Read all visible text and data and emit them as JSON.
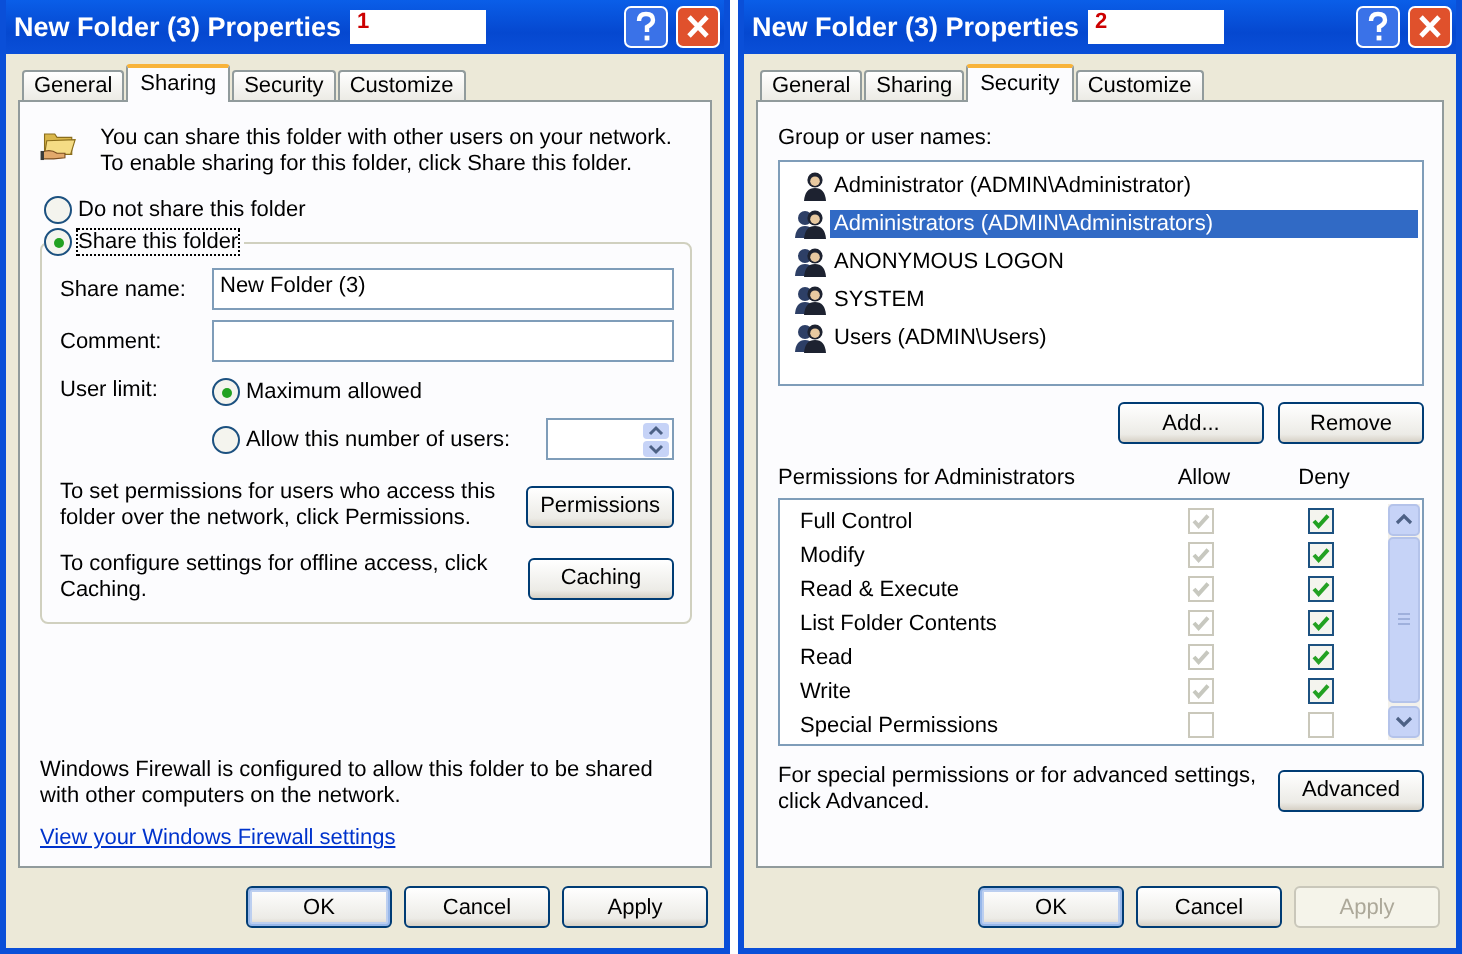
{
  "dialogs": [
    {
      "kind": "sharing",
      "title": "New Folder (3) Properties",
      "badge": "1",
      "tabs": [
        {
          "label": "General",
          "selected": false
        },
        {
          "label": "Sharing",
          "selected": true
        },
        {
          "label": "Security",
          "selected": false
        },
        {
          "label": "Customize",
          "selected": false
        }
      ],
      "intro": "You can share this folder with other users on your network.  To enable sharing for this folder, click Share this folder.",
      "share_options": [
        {
          "label": "Do not share this folder",
          "selected": false
        },
        {
          "label": "Share this folder",
          "selected": true
        }
      ],
      "share_name": {
        "label": "Share name:",
        "value": "New Folder (3)"
      },
      "comment": {
        "label": "Comment:"
      },
      "user_limit": {
        "label": "User limit:",
        "options": [
          {
            "label": "Maximum allowed",
            "selected": true
          },
          {
            "label": "Allow this number of users:",
            "selected": false
          }
        ]
      },
      "permissions_text": "To set permissions for users who access this folder over the network, click Permissions.",
      "permissions_button": "Permissions",
      "caching_text": "To configure settings for offline access, click Caching.",
      "caching_button": "Caching",
      "firewall_text": "Windows Firewall is configured to allow this folder to be shared with other computers on the network.",
      "firewall_link": "View your Windows Firewall settings",
      "buttons": [
        {
          "label": "OK",
          "default": true,
          "disabled": false
        },
        {
          "label": "Cancel",
          "default": false,
          "disabled": false
        },
        {
          "label": "Apply",
          "default": false,
          "disabled": false
        }
      ]
    },
    {
      "kind": "security",
      "title": "New Folder (3) Properties",
      "badge": "2",
      "tabs": [
        {
          "label": "General",
          "selected": false
        },
        {
          "label": "Sharing",
          "selected": false
        },
        {
          "label": "Security",
          "selected": true
        },
        {
          "label": "Customize",
          "selected": false
        }
      ],
      "group_label": "Group or user names:",
      "users": [
        {
          "name": "Administrator (ADMIN\\Administrator)",
          "kind": "user",
          "selected": false
        },
        {
          "name": "Administrators (ADMIN\\Administrators)",
          "kind": "group",
          "selected": true
        },
        {
          "name": "ANONYMOUS LOGON",
          "kind": "group",
          "selected": false
        },
        {
          "name": "SYSTEM",
          "kind": "group",
          "selected": false
        },
        {
          "name": "Users (ADMIN\\Users)",
          "kind": "group",
          "selected": false
        }
      ],
      "user_buttons": [
        "Add...",
        "Remove"
      ],
      "permissions_label": "Permissions for Administrators",
      "columns": [
        "Allow",
        "Deny"
      ],
      "permissions": [
        {
          "name": "Full Control",
          "allow": {
            "checked": true,
            "disabled": true
          },
          "deny": {
            "checked": true,
            "disabled": false
          }
        },
        {
          "name": "Modify",
          "allow": {
            "checked": true,
            "disabled": true
          },
          "deny": {
            "checked": true,
            "disabled": false
          }
        },
        {
          "name": "Read & Execute",
          "allow": {
            "checked": true,
            "disabled": true
          },
          "deny": {
            "checked": true,
            "disabled": false
          }
        },
        {
          "name": "List Folder Contents",
          "allow": {
            "checked": true,
            "disabled": true
          },
          "deny": {
            "checked": true,
            "disabled": false
          }
        },
        {
          "name": "Read",
          "allow": {
            "checked": true,
            "disabled": true
          },
          "deny": {
            "checked": true,
            "disabled": false
          }
        },
        {
          "name": "Write",
          "allow": {
            "checked": true,
            "disabled": true
          },
          "deny": {
            "checked": true,
            "disabled": false
          }
        },
        {
          "name": "Special Permissions",
          "allow": {
            "checked": false,
            "disabled": true
          },
          "deny": {
            "checked": false,
            "disabled": true
          }
        }
      ],
      "advanced_text": "For special permissions or for advanced settings, click Advanced.",
      "advanced_button": "Advanced",
      "buttons": [
        {
          "label": "OK",
          "default": true,
          "disabled": false
        },
        {
          "label": "Cancel",
          "default": false,
          "disabled": false
        },
        {
          "label": "Apply",
          "default": false,
          "disabled": true
        }
      ]
    }
  ]
}
